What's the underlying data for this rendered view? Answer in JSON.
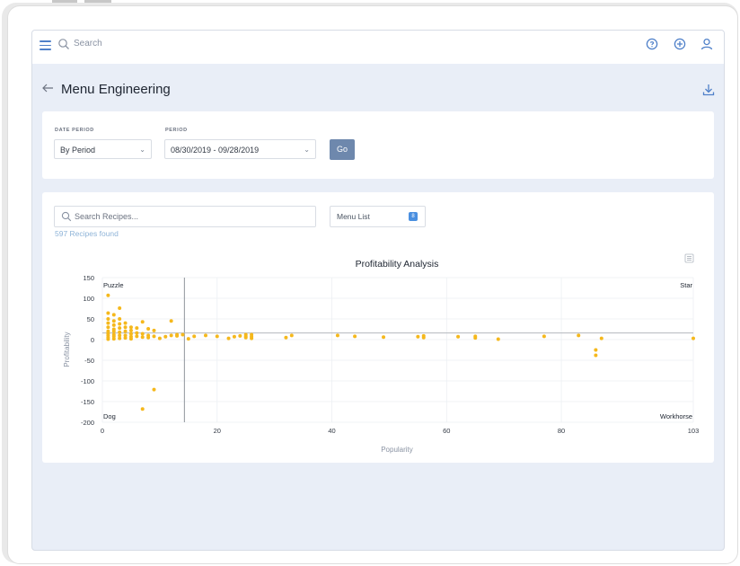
{
  "topbar": {
    "search_placeholder": "Search"
  },
  "page": {
    "title": "Menu Engineering"
  },
  "filters": {
    "date_period_label": "DATE PERIOD",
    "date_period_value": "By Period",
    "period_label": "PERIOD",
    "period_value": "08/30/2019 - 09/28/2019",
    "go_label": "Go"
  },
  "recipes": {
    "search_placeholder": "Search Recipes...",
    "found_text": "597 Recipes found",
    "menu_list_label": "Menu List",
    "menu_list_count": "8"
  },
  "colors": {
    "accent": "#4f80c9",
    "point": "#f5b81c",
    "button": "#6e88ad"
  },
  "chart_data": {
    "type": "scatter",
    "title": "Profitability Analysis",
    "xlabel": "Popularity",
    "ylabel": "Profitability",
    "xlim": [
      0,
      103
    ],
    "ylim": [
      -200,
      150
    ],
    "xticks": [
      "0",
      "20",
      "40",
      "60",
      "80",
      "103"
    ],
    "yticks": [
      "150",
      "100",
      "50",
      "0",
      "-50",
      "-100",
      "-150",
      "-200"
    ],
    "grid": true,
    "quadrant_labels": {
      "top_left": "Puzzle",
      "top_right": "Star",
      "bottom_left": "Dog",
      "bottom_right": "Workhorse"
    },
    "divider_x": 14.3,
    "divider_y": 16,
    "points": [
      [
        1,
        107
      ],
      [
        1,
        64
      ],
      [
        1,
        50
      ],
      [
        1,
        40
      ],
      [
        1,
        30
      ],
      [
        1,
        20
      ],
      [
        1,
        15
      ],
      [
        1,
        10
      ],
      [
        1,
        5
      ],
      [
        1,
        1
      ],
      [
        2,
        60
      ],
      [
        2,
        45
      ],
      [
        2,
        35
      ],
      [
        2,
        25
      ],
      [
        2,
        20
      ],
      [
        2,
        12
      ],
      [
        2,
        8
      ],
      [
        2,
        2
      ],
      [
        3,
        76
      ],
      [
        3,
        50
      ],
      [
        3,
        38
      ],
      [
        3,
        28
      ],
      [
        3,
        18
      ],
      [
        3,
        10
      ],
      [
        3,
        3
      ],
      [
        4,
        40
      ],
      [
        4,
        30
      ],
      [
        4,
        20
      ],
      [
        4,
        10
      ],
      [
        4,
        4
      ],
      [
        5,
        30
      ],
      [
        5,
        22
      ],
      [
        5,
        14
      ],
      [
        5,
        7
      ],
      [
        5,
        2
      ],
      [
        6,
        28
      ],
      [
        6,
        16
      ],
      [
        6,
        8
      ],
      [
        7,
        43
      ],
      [
        7,
        14
      ],
      [
        7,
        6
      ],
      [
        7,
        -168
      ],
      [
        8,
        26
      ],
      [
        8,
        10
      ],
      [
        8,
        5
      ],
      [
        9,
        22
      ],
      [
        9,
        8
      ],
      [
        9,
        -121
      ],
      [
        10,
        3
      ],
      [
        11,
        7
      ],
      [
        12,
        10
      ],
      [
        12,
        45
      ],
      [
        13,
        9
      ],
      [
        13,
        12
      ],
      [
        14,
        12
      ],
      [
        15,
        2
      ],
      [
        16,
        8
      ],
      [
        18,
        10
      ],
      [
        20,
        8
      ],
      [
        22,
        3
      ],
      [
        23,
        7
      ],
      [
        24,
        9
      ],
      [
        25,
        12
      ],
      [
        25,
        8
      ],
      [
        25,
        5
      ],
      [
        26,
        3
      ],
      [
        26,
        7
      ],
      [
        26,
        12
      ],
      [
        32,
        5
      ],
      [
        33,
        10
      ],
      [
        41,
        10
      ],
      [
        44,
        8
      ],
      [
        49,
        6
      ],
      [
        55,
        7
      ],
      [
        56,
        9
      ],
      [
        56,
        5
      ],
      [
        62,
        7
      ],
      [
        65,
        8
      ],
      [
        65,
        4
      ],
      [
        69,
        1
      ],
      [
        77,
        8
      ],
      [
        83,
        10
      ],
      [
        86,
        -38
      ],
      [
        86,
        -25
      ],
      [
        87,
        3
      ],
      [
        103,
        3
      ]
    ]
  }
}
